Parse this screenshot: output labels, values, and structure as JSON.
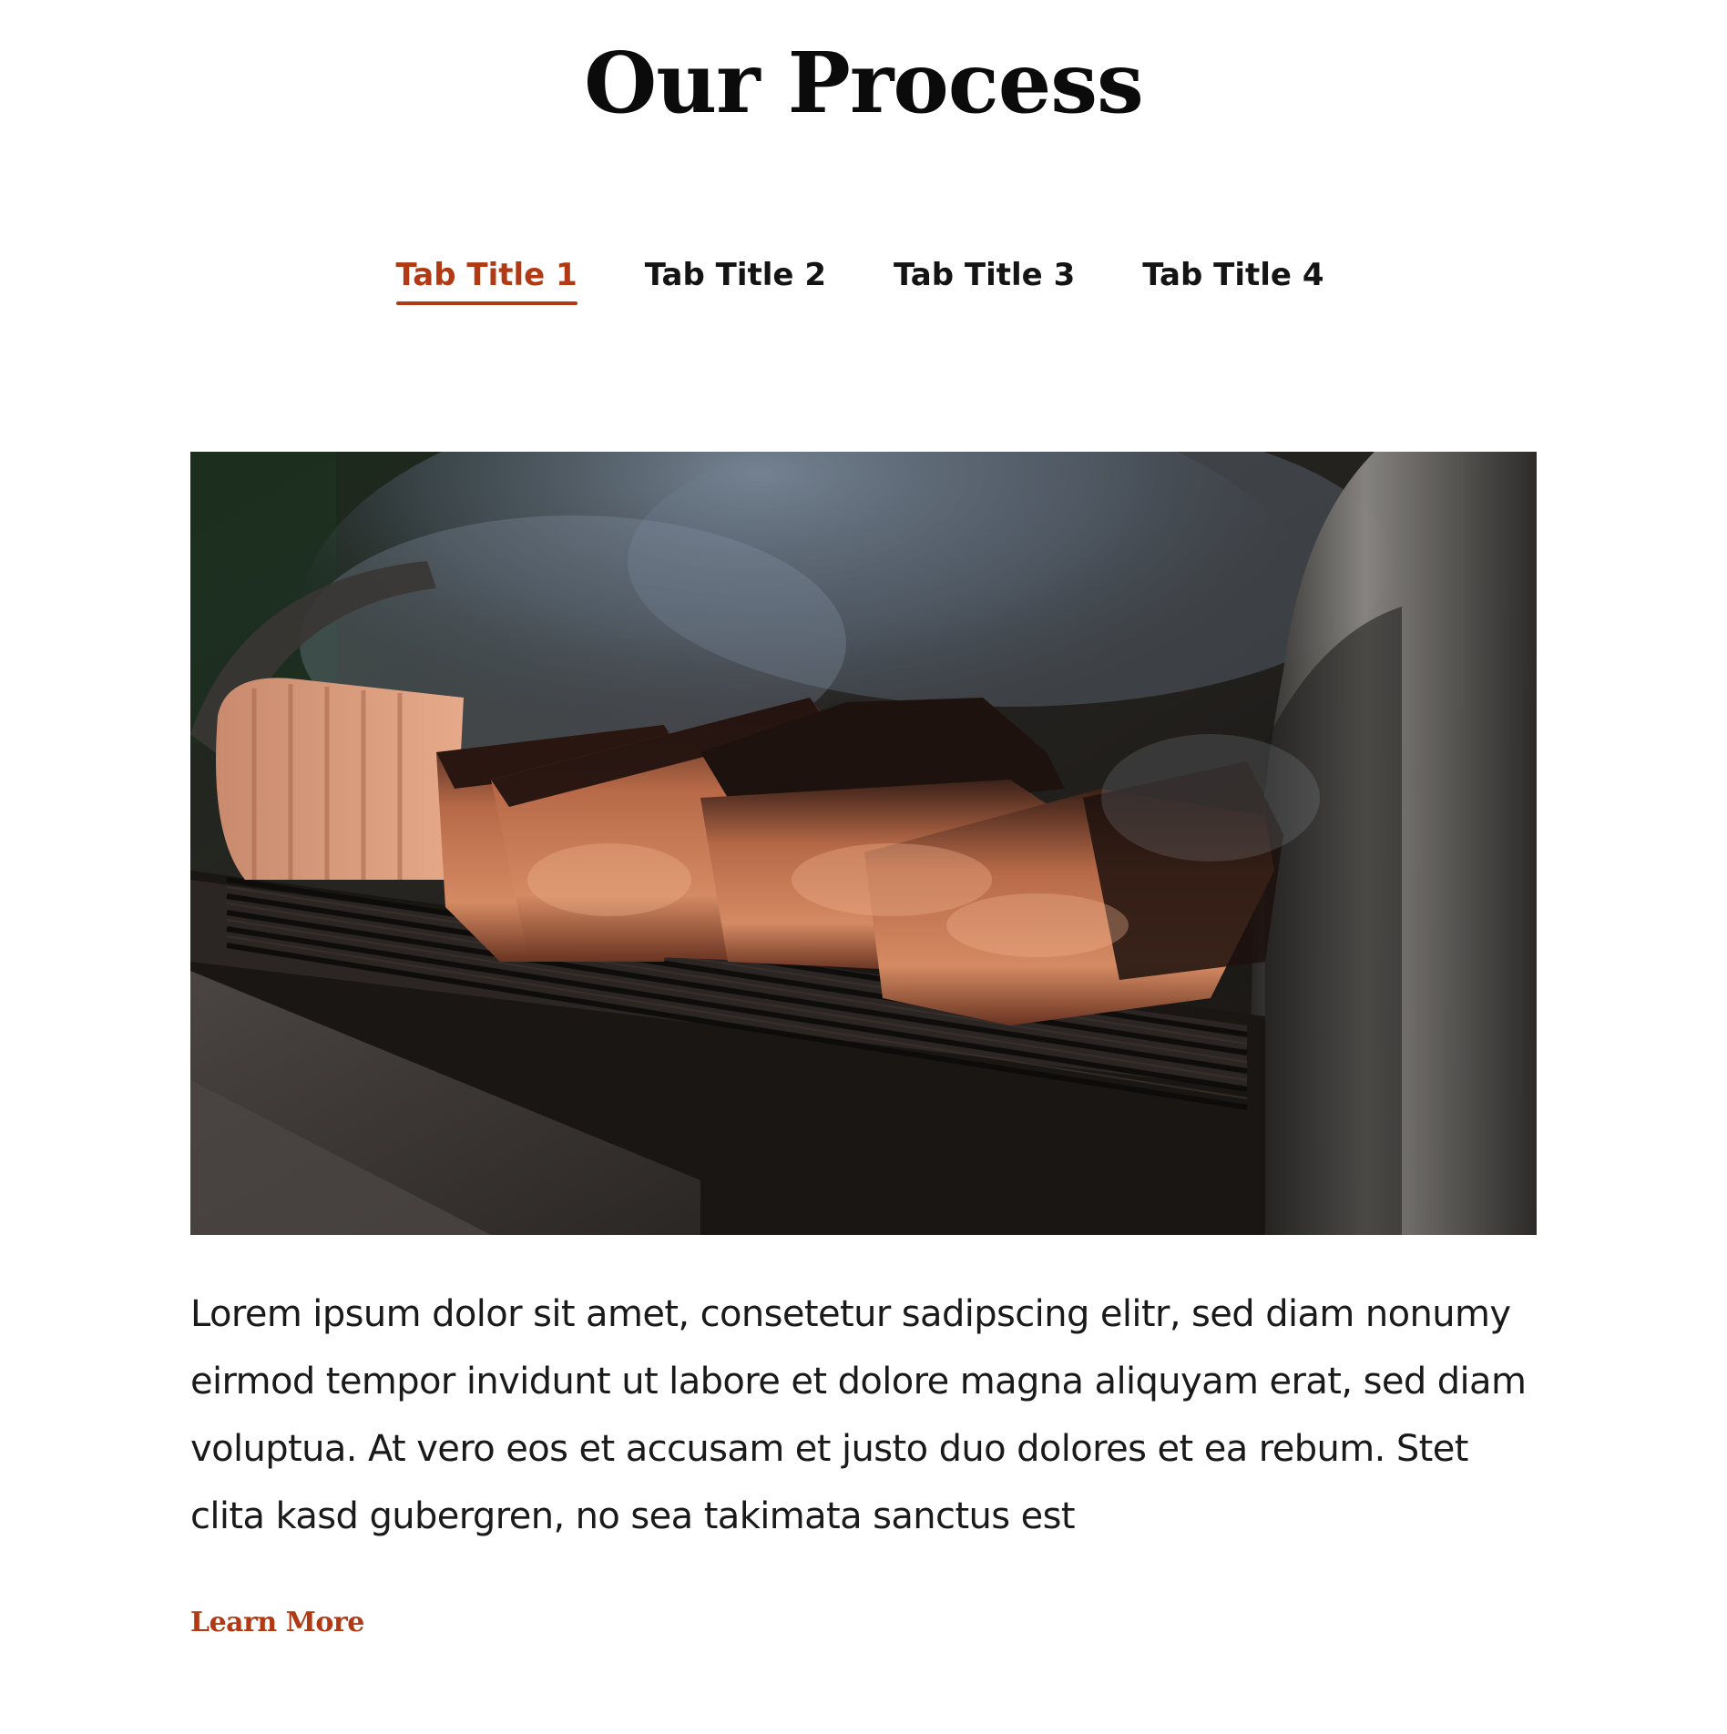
{
  "section": {
    "title": "Our Process"
  },
  "tabs": [
    {
      "label": "Tab Title 1",
      "active": true
    },
    {
      "label": "Tab Title 2",
      "active": false
    },
    {
      "label": "Tab Title 3",
      "active": false
    },
    {
      "label": "Tab Title 4",
      "active": false
    }
  ],
  "content": {
    "image_subject": "smoked-brisket-on-grill",
    "body": "Lorem ipsum dolor sit amet, consetetur sadipscing elitr, sed diam nonumy eirmod tempor invidunt ut labore et dolore magna aliquyam erat, sed diam voluptua. At vero eos et accusam et justo duo dolores et ea rebum. Stet clita kasd gubergren, no sea takimata sanctus est",
    "link_label": "Learn More"
  },
  "colors": {
    "accent": "#b13a14",
    "text": "#111111",
    "background": "#ffffff"
  }
}
